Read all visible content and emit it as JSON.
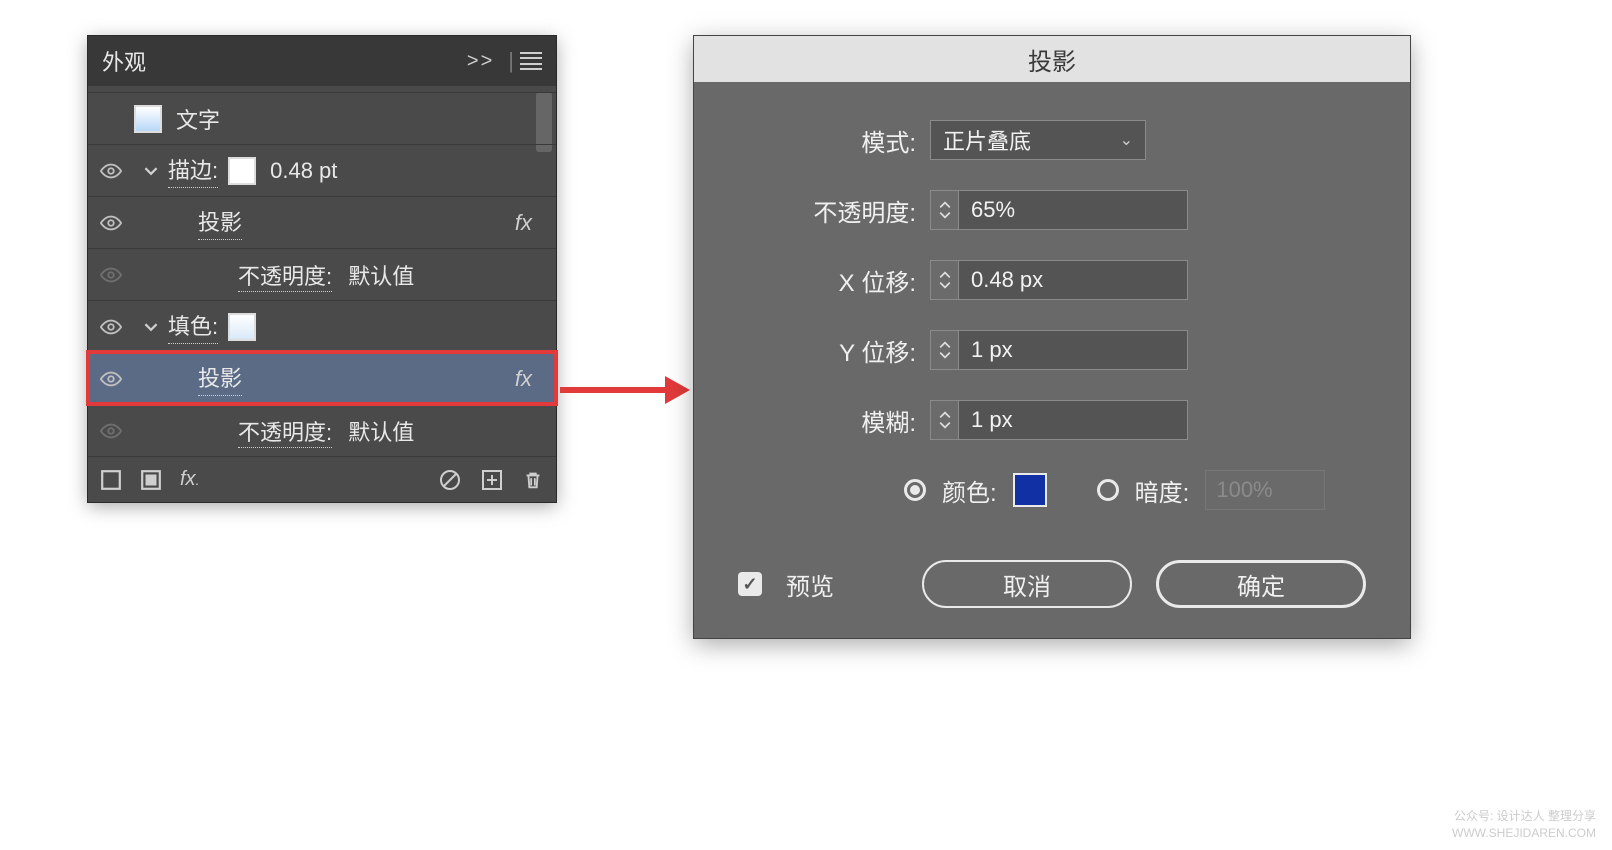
{
  "panel": {
    "title": "外观",
    "header_chevrons": ">>",
    "rows": {
      "text_label": "文字",
      "stroke_label": "描边:",
      "stroke_value": "0.48 pt",
      "shadow_label": "投影",
      "opacity_label": "不透明度:",
      "opacity_value": "默认值",
      "fill_label": "填色:",
      "shadow2_label": "投影",
      "opacity2_label": "不透明度:",
      "opacity2_value": "默认值"
    },
    "footer": {
      "fx_label": "fx"
    }
  },
  "dialog": {
    "title": "投影",
    "fields": {
      "mode_label": "模式:",
      "mode_value": "正片叠底",
      "opacity_label": "不透明度:",
      "opacity_value": "65%",
      "x_label": "X 位移:",
      "x_value": "0.48 px",
      "y_label": "Y 位移:",
      "y_value": "1 px",
      "blur_label": "模糊:",
      "blur_value": "1 px",
      "color_label": "颜色:",
      "darkness_label": "暗度:",
      "darkness_value": "100%"
    },
    "preview_label": "预览",
    "cancel_label": "取消",
    "ok_label": "确定",
    "color_hex": "#1030a4"
  },
  "watermark": {
    "line1": "公众号: 设计达人 整理分享",
    "line2": "WWW.SHEJIDAREN.COM"
  }
}
